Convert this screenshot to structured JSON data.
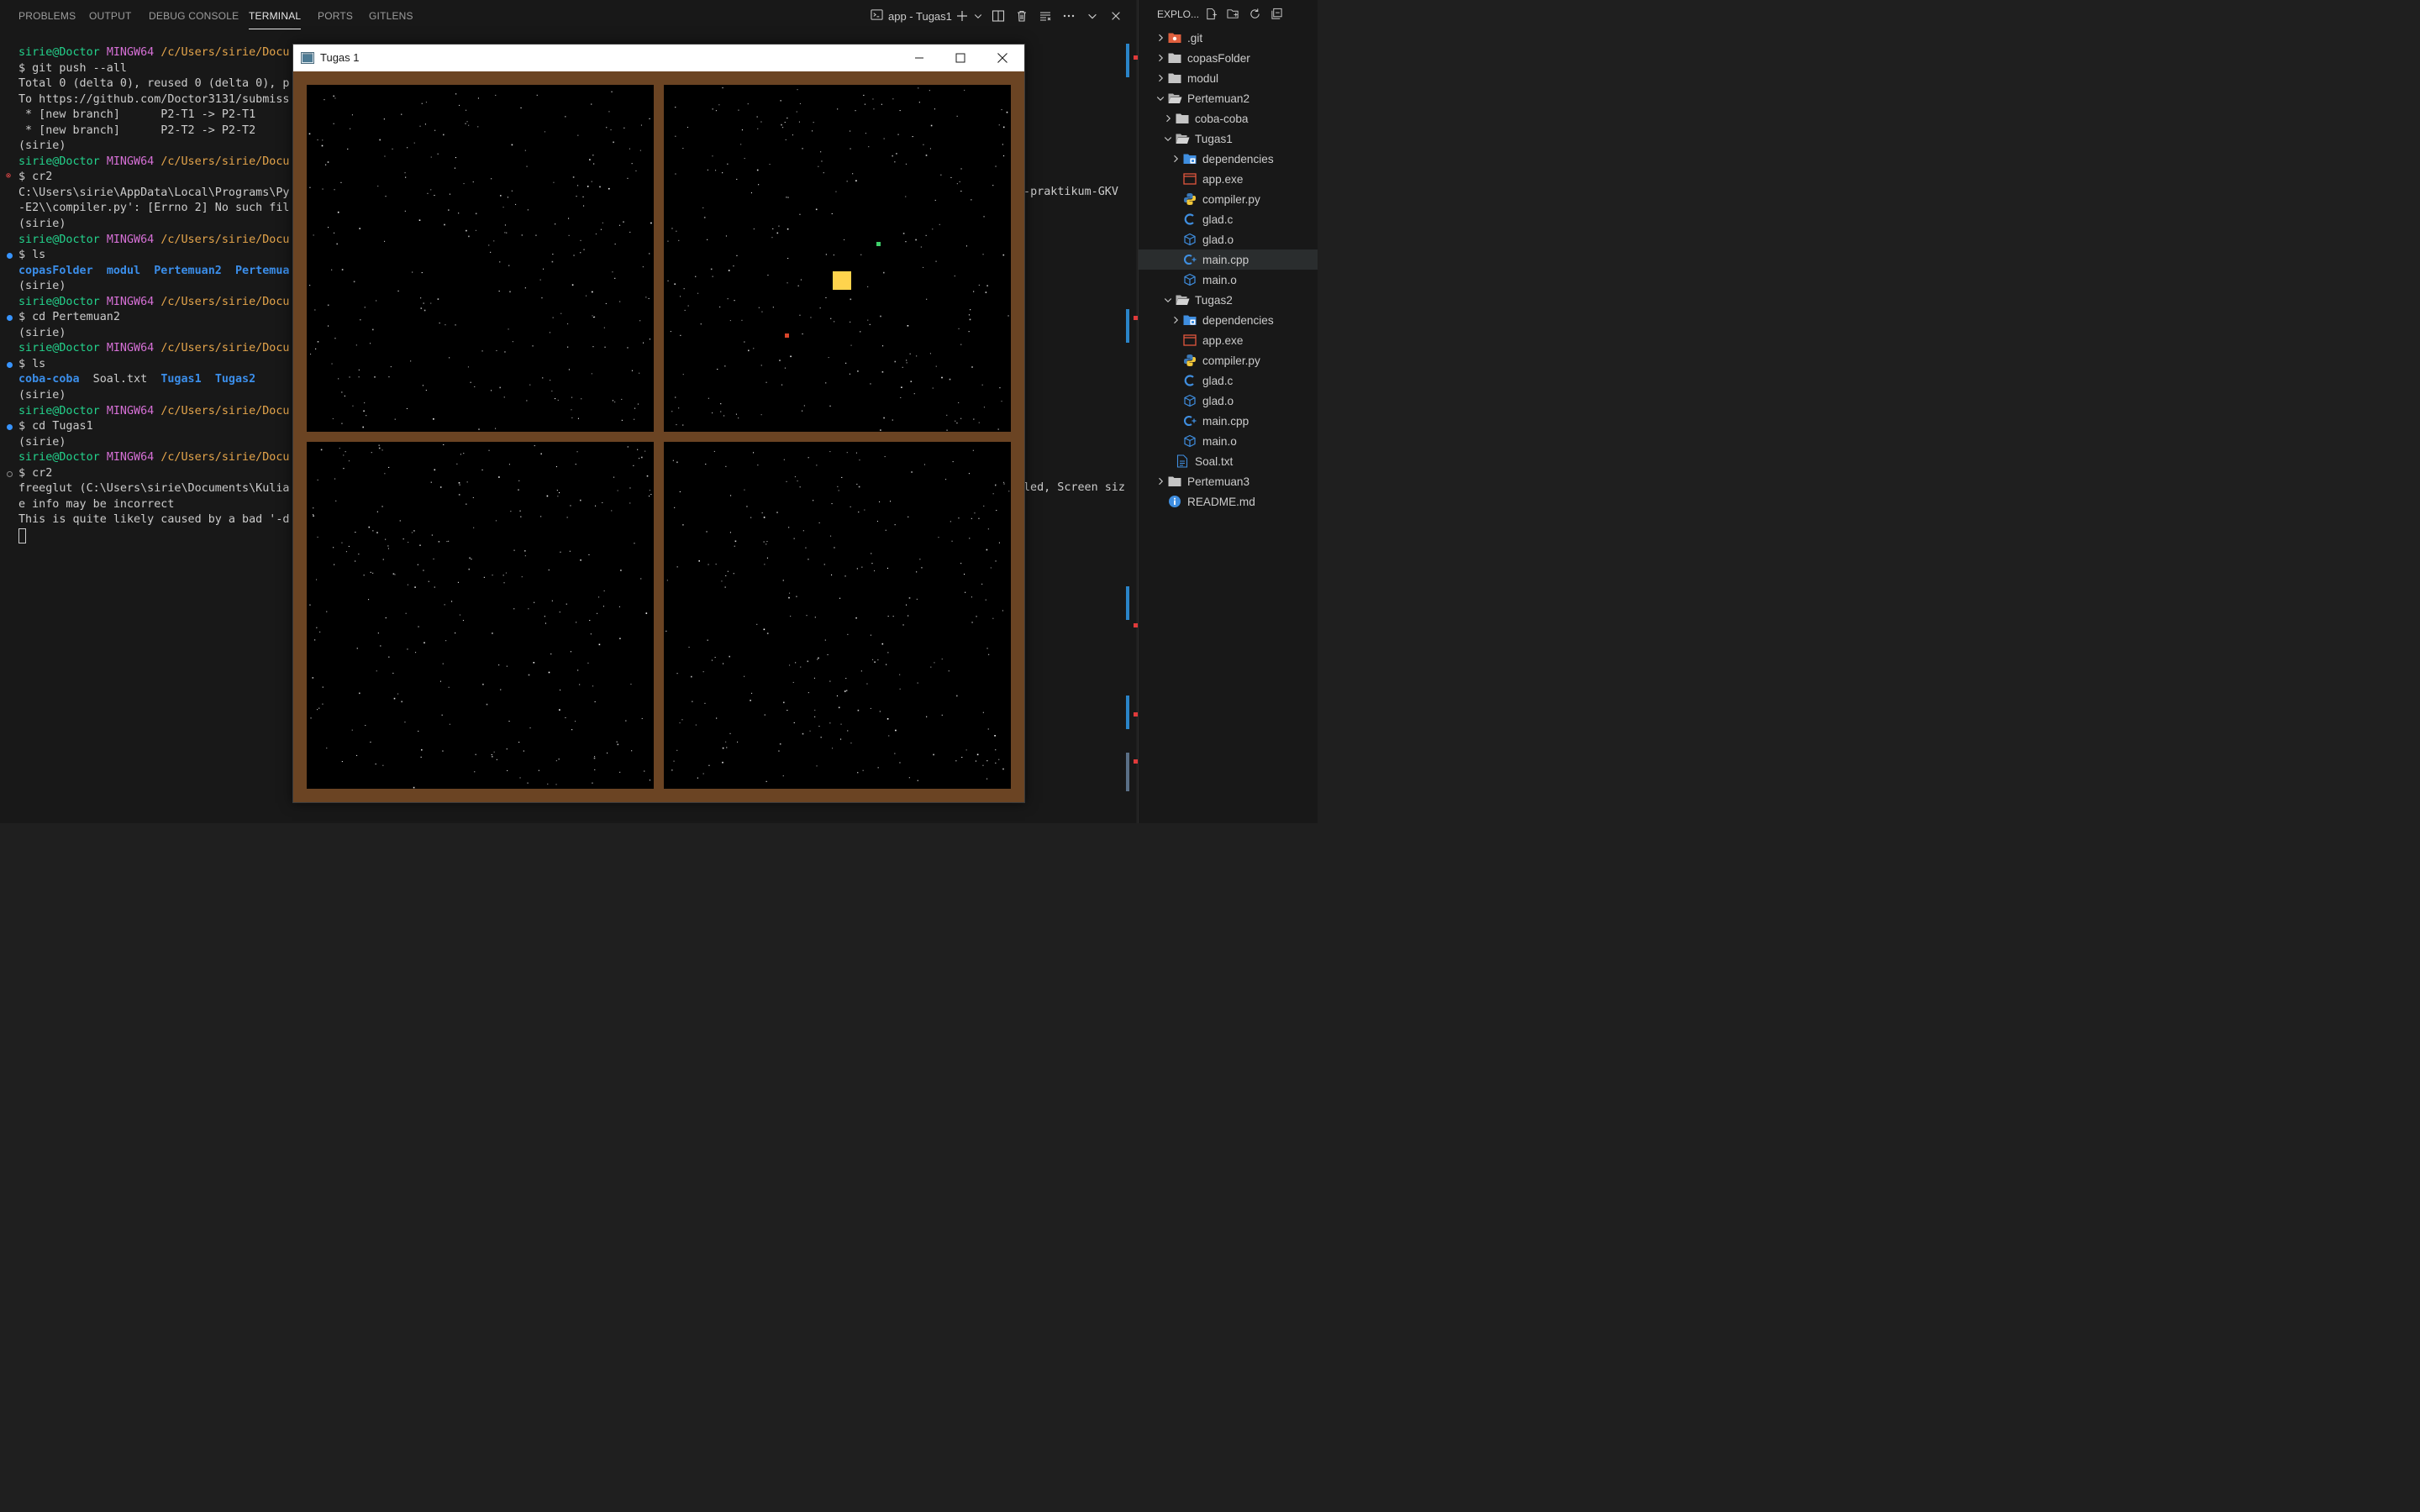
{
  "panel": {
    "tabs": [
      {
        "label": "PROBLEMS"
      },
      {
        "label": "OUTPUT"
      },
      {
        "label": "DEBUG CONSOLE"
      },
      {
        "label": "TERMINAL",
        "active": true
      },
      {
        "label": "PORTS"
      },
      {
        "label": "GITLENS"
      }
    ],
    "terminal_name": "app - Tugas1",
    "toolbar_icons": [
      "terminal-icon",
      "plus-icon",
      "chevron-down-icon",
      "split-icon",
      "trash-icon",
      "clear-icon",
      "more-icon",
      "chevron-down-icon",
      "close-icon"
    ]
  },
  "terminal": {
    "prompt": {
      "user": "sirie@Doctor",
      "host": "MINGW64",
      "path": "/c/Users/sirie/Docu"
    },
    "lines": [
      {
        "kind": "prompt"
      },
      {
        "kind": "text",
        "text": "$ git push --all"
      },
      {
        "kind": "text",
        "text": "Total 0 (delta 0), reused 0 (delta 0), p"
      },
      {
        "kind": "text",
        "text": "To https://github.com/Doctor3131/submiss"
      },
      {
        "kind": "text",
        "text": " * [new branch]      P2-T1 -> P2-T1"
      },
      {
        "kind": "text",
        "text": " * [new branch]      P2-T2 -> P2-T2"
      },
      {
        "kind": "text",
        "text": "(sirie)"
      },
      {
        "kind": "prompt"
      },
      {
        "kind": "text",
        "text": "$ cr2",
        "marker": "err"
      },
      {
        "kind": "text",
        "text": "C:\\Users\\sirie\\AppData\\Local\\Programs\\Py"
      },
      {
        "kind": "text",
        "text": "-E2\\\\compiler.py': [Errno 2] No such fil"
      },
      {
        "kind": "text",
        "text": "(sirie)"
      },
      {
        "kind": "prompt"
      },
      {
        "kind": "text",
        "text": "$ ls",
        "marker": "blue"
      },
      {
        "kind": "dirs",
        "items": [
          {
            "text": "copasFolder",
            "dir": true
          },
          {
            "text": "  "
          },
          {
            "text": "modul",
            "dir": true
          },
          {
            "text": "  "
          },
          {
            "text": "Pertemuan2",
            "dir": true
          },
          {
            "text": "  "
          },
          {
            "text": "Pertemua",
            "dir": true
          }
        ]
      },
      {
        "kind": "text",
        "text": "(sirie)"
      },
      {
        "kind": "prompt"
      },
      {
        "kind": "text",
        "text": "$ cd Pertemuan2",
        "marker": "blue"
      },
      {
        "kind": "text",
        "text": "(sirie)"
      },
      {
        "kind": "prompt"
      },
      {
        "kind": "text",
        "text": "$ ls",
        "marker": "blue"
      },
      {
        "kind": "dirs",
        "items": [
          {
            "text": "coba-coba",
            "dir": true
          },
          {
            "text": "  Soal.txt  "
          },
          {
            "text": "Tugas1",
            "dir": true
          },
          {
            "text": "  "
          },
          {
            "text": "Tugas2",
            "dir": true
          }
        ]
      },
      {
        "kind": "text",
        "text": "(sirie)"
      },
      {
        "kind": "prompt"
      },
      {
        "kind": "text",
        "text": "$ cd Tugas1",
        "marker": "blue"
      },
      {
        "kind": "text",
        "text": "(sirie)"
      },
      {
        "kind": "prompt"
      },
      {
        "kind": "text",
        "text": "$ cr2",
        "marker": "hollow"
      },
      {
        "kind": "text",
        "text": "freeglut (C:\\Users\\sirie\\Documents\\Kulia"
      },
      {
        "kind": "text",
        "text": "e info may be incorrect"
      },
      {
        "kind": "text",
        "text": "This is quite likely caused by a bad '-d"
      },
      {
        "kind": "cursor"
      }
    ],
    "right_fragment_1": "n-praktikum-GKV",
    "right_fragment_2": "led, Screen siz"
  },
  "explorer": {
    "title": "EXPLO...",
    "header_icons": [
      "new-file-icon",
      "new-folder-icon",
      "refresh-icon",
      "collapse-all-icon"
    ],
    "items": [
      {
        "label": ".git",
        "depth": 0,
        "type": "folder",
        "expanded": false,
        "icon": "git-folder-icon"
      },
      {
        "label": "copasFolder",
        "depth": 0,
        "type": "folder",
        "expanded": false,
        "icon": "folder-icon"
      },
      {
        "label": "modul",
        "depth": 0,
        "type": "folder",
        "expanded": false,
        "icon": "folder-icon"
      },
      {
        "label": "Pertemuan2",
        "depth": 0,
        "type": "folder",
        "expanded": true,
        "icon": "folder-open-icon"
      },
      {
        "label": "coba-coba",
        "depth": 1,
        "type": "folder",
        "expanded": false,
        "icon": "folder-icon"
      },
      {
        "label": "Tugas1",
        "depth": 1,
        "type": "folder",
        "expanded": true,
        "icon": "folder-open-icon"
      },
      {
        "label": "dependencies",
        "depth": 2,
        "type": "folder",
        "expanded": false,
        "icon": "dependencies-folder-icon"
      },
      {
        "label": "app.exe",
        "depth": 2,
        "type": "file",
        "icon": "exe-file-icon"
      },
      {
        "label": "compiler.py",
        "depth": 2,
        "type": "file",
        "icon": "python-file-icon"
      },
      {
        "label": "glad.c",
        "depth": 2,
        "type": "file",
        "icon": "c-file-icon"
      },
      {
        "label": "glad.o",
        "depth": 2,
        "type": "file",
        "icon": "object-file-icon"
      },
      {
        "label": "main.cpp",
        "depth": 2,
        "type": "file",
        "icon": "cpp-file-icon",
        "selected": true
      },
      {
        "label": "main.o",
        "depth": 2,
        "type": "file",
        "icon": "object-file-icon"
      },
      {
        "label": "Tugas2",
        "depth": 1,
        "type": "folder",
        "expanded": true,
        "icon": "folder-open-icon"
      },
      {
        "label": "dependencies",
        "depth": 2,
        "type": "folder",
        "expanded": false,
        "icon": "dependencies-folder-icon"
      },
      {
        "label": "app.exe",
        "depth": 2,
        "type": "file",
        "icon": "exe-file-icon"
      },
      {
        "label": "compiler.py",
        "depth": 2,
        "type": "file",
        "icon": "python-file-icon"
      },
      {
        "label": "glad.c",
        "depth": 2,
        "type": "file",
        "icon": "c-file-icon"
      },
      {
        "label": "glad.o",
        "depth": 2,
        "type": "file",
        "icon": "object-file-icon"
      },
      {
        "label": "main.cpp",
        "depth": 2,
        "type": "file",
        "icon": "cpp-file-icon"
      },
      {
        "label": "main.o",
        "depth": 2,
        "type": "file",
        "icon": "object-file-icon"
      },
      {
        "label": "Soal.txt",
        "depth": 1,
        "type": "file",
        "icon": "text-file-icon"
      },
      {
        "label": "Pertemuan3",
        "depth": 0,
        "type": "folder",
        "expanded": false,
        "icon": "folder-icon"
      },
      {
        "label": "README.md",
        "depth": 0,
        "type": "file",
        "icon": "info-icon"
      }
    ]
  },
  "gl_window": {
    "title": "Tugas 1",
    "controls": [
      "minimize-icon",
      "maximize-icon",
      "close-icon"
    ],
    "colors": {
      "frame": "#6b4423",
      "sky": "#000000",
      "sun": "#ffd34d",
      "planet_green": "#3ecf6a",
      "planet_red": "#d9452b",
      "star": "#ffffff"
    }
  },
  "colors": {
    "user": "#23d18b",
    "host": "#d670d6",
    "path": "#e5a54b",
    "dir": "#3b8eea",
    "accent": "#3794ff"
  }
}
